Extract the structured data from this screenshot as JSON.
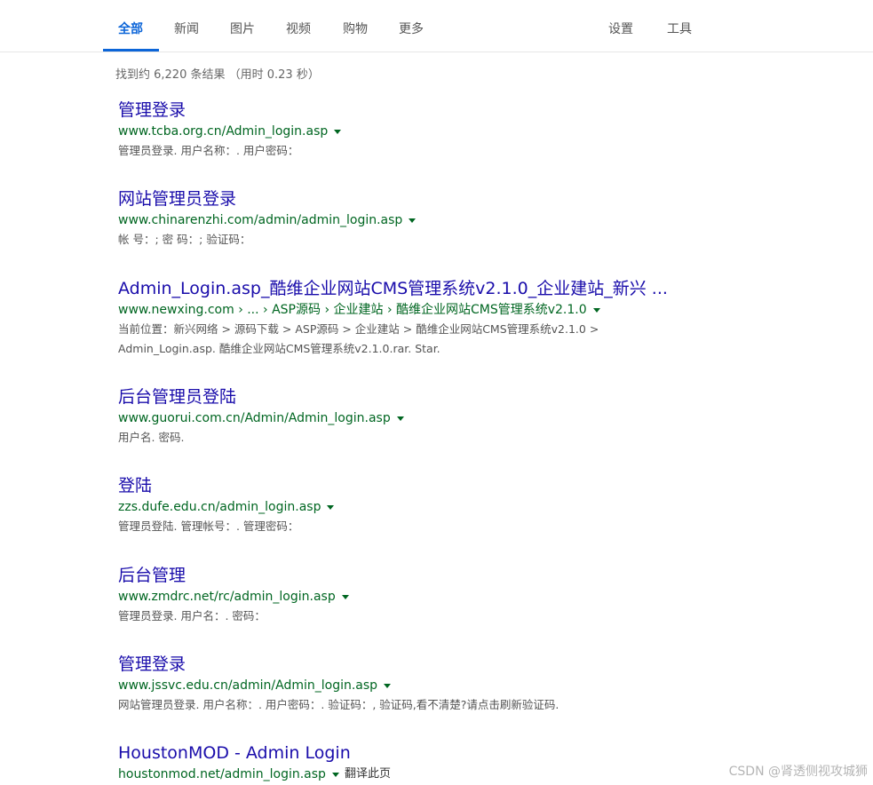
{
  "nav": {
    "tabs": [
      "全部",
      "新闻",
      "图片",
      "视频",
      "购物",
      "更多"
    ],
    "settings": "设置",
    "tools": "工具"
  },
  "stats": "找到约 6,220 条结果 （用时 0.23 秒）",
  "results": [
    {
      "title": "管理登录",
      "url": "www.tcba.org.cn/Admin_login.asp",
      "snippet": "管理员登录. 用户名称：. 用户密码："
    },
    {
      "title": "网站管理员登录",
      "url": "www.chinarenzhi.com/admin/admin_login.asp",
      "snippet": "帐 号：; 密 码：; 验证码："
    },
    {
      "title": "Admin_Login.asp_酷维企业网站CMS管理系统v2.1.0_企业建站_新兴 ...",
      "url": "www.newxing.com › ... › ASP源码 › 企业建站 › 酷维企业网站CMS管理系统v2.1.0",
      "snippet": "当前位置：新兴网络 > 源码下载 > ASP源码 > 企业建站 > 酷维企业网站CMS管理系统v2.1.0 > Admin_Login.asp. 酷维企业网站CMS管理系统v2.1.0.rar. Star."
    },
    {
      "title": "后台管理员登陆",
      "url": "www.guorui.com.cn/Admin/Admin_login.asp",
      "snippet": "用户名. 密码."
    },
    {
      "title": "登陆",
      "url": "zzs.dufe.edu.cn/admin_login.asp",
      "snippet": "管理员登陆. 管理帐号：. 管理密码："
    },
    {
      "title": "后台管理",
      "url": "www.zmdrc.net/rc/admin_login.asp",
      "snippet": "管理员登录. 用户名：. 密码："
    },
    {
      "title": "管理登录",
      "url": "www.jssvc.edu.cn/admin/Admin_login.asp",
      "snippet": "网站管理员登录. 用户名称：. 用户密码：. 验证码：, 验证码,看不清楚?请点击刷新验证码."
    },
    {
      "title": "HoustonMOD - Admin Login",
      "url": "houstonmod.net/admin_login.asp",
      "snippet": "",
      "translate": "翻译此页"
    }
  ],
  "watermark": "CSDN @肾透侧视攻城狮"
}
